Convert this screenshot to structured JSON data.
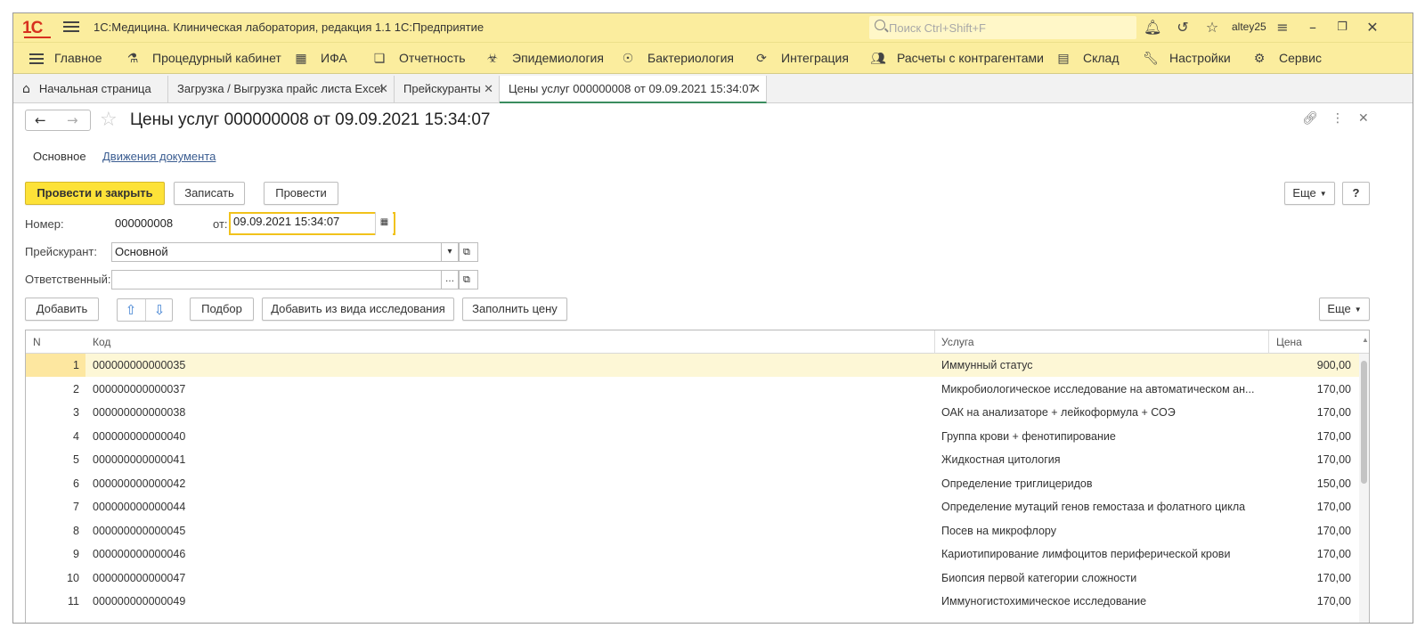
{
  "titlebar": {
    "logo": "1С",
    "title": "1С:Медицина. Клиническая лаборатория, редакция 1.1 1С:Предприятие",
    "search_placeholder": "Поиск Ctrl+Shift+F",
    "user": "altey25"
  },
  "menu": [
    {
      "label": "Главное",
      "icon": "menu-icon"
    },
    {
      "label": "Процедурный кабинет",
      "icon": "vial-icon"
    },
    {
      "label": "ИФА",
      "icon": "grid-icon"
    },
    {
      "label": "Отчетность",
      "icon": "documents-icon"
    },
    {
      "label": "Эпидемиология",
      "icon": "biohazard-icon"
    },
    {
      "label": "Бактериология",
      "icon": "bacteria-icon"
    },
    {
      "label": "Интеграция",
      "icon": "sync-icon"
    },
    {
      "label": "Расчеты с контрагентами",
      "icon": "people-icon"
    },
    {
      "label": "Склад",
      "icon": "warehouse-icon"
    },
    {
      "label": "Настройки",
      "icon": "wrench-icon"
    },
    {
      "label": "Сервис",
      "icon": "gear-icon"
    }
  ],
  "tabs": [
    {
      "label": "Начальная страница"
    },
    {
      "label": "Загрузка / Выгрузка прайс листа Excel"
    },
    {
      "label": "Прейскуранты"
    },
    {
      "label": "Цены услуг 000000008 от 09.09.2021 15:34:07"
    }
  ],
  "document": {
    "title": "Цены услуг 000000008 от 09.09.2021 15:34:07",
    "subtab_main": "Основное",
    "subtab_movements": "Движения документа",
    "btn_post_close": "Провести и закрыть",
    "btn_save": "Записать",
    "btn_post": "Провести",
    "btn_more": "Еще",
    "btn_help": "?",
    "number_label": "Номер:",
    "number_value": "000000008",
    "date_label": "от:",
    "date_value": "09.09.2021 15:34:07",
    "pricelist_label": "Прейскурант:",
    "pricelist_value": "Основной",
    "responsible_label": "Ответственный:",
    "responsible_value": ""
  },
  "table_toolbar": {
    "add": "Добавить",
    "pick": "Подбор",
    "add_from_type": "Добавить из вида исследования",
    "fill_price": "Заполнить цену",
    "more": "Еще"
  },
  "table": {
    "columns": {
      "n": "N",
      "code": "Код",
      "service": "Услуга",
      "price": "Цена"
    },
    "rows": [
      {
        "n": "1",
        "code": "000000000000035",
        "service": "Иммунный статус",
        "price": "900,00"
      },
      {
        "n": "2",
        "code": "000000000000037",
        "service": "Микробиологическое исследование на автоматическом ан...",
        "price": "170,00"
      },
      {
        "n": "3",
        "code": "000000000000038",
        "service": "ОАК на анализаторе + лейкоформула + СОЭ",
        "price": "170,00"
      },
      {
        "n": "4",
        "code": "000000000000040",
        "service": "Группа крови + фенотипирование",
        "price": "170,00"
      },
      {
        "n": "5",
        "code": "000000000000041",
        "service": "Жидкостная цитология",
        "price": "170,00"
      },
      {
        "n": "6",
        "code": "000000000000042",
        "service": "Определение триглицеридов",
        "price": "150,00"
      },
      {
        "n": "7",
        "code": "000000000000044",
        "service": "Определение мутаций генов гемостаза и фолатного цикла",
        "price": "170,00"
      },
      {
        "n": "8",
        "code": "000000000000045",
        "service": "Посев на микрофлору",
        "price": "170,00"
      },
      {
        "n": "9",
        "code": "000000000000046",
        "service": "Кариотипирование лимфоцитов периферической крови",
        "price": "170,00"
      },
      {
        "n": "10",
        "code": "000000000000047",
        "service": "Биопсия первой категории сложности",
        "price": "170,00"
      },
      {
        "n": "11",
        "code": "000000000000049",
        "service": "Иммуногистохимическое исследование",
        "price": "170,00"
      }
    ]
  },
  "colors": {
    "accent": "#fde238",
    "bar": "#fbed9e",
    "logo": "#d7301f",
    "link": "#3b5d91"
  }
}
